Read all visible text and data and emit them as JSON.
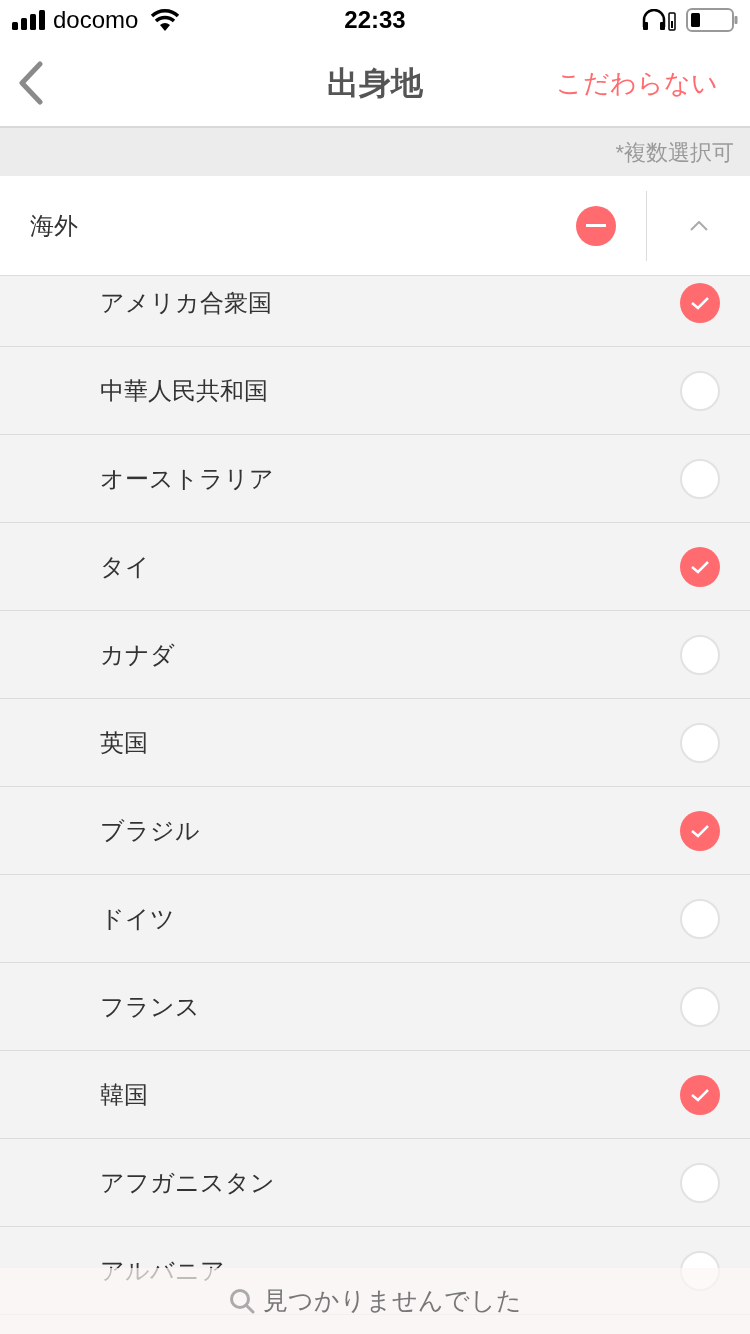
{
  "status_bar": {
    "carrier": "docomo",
    "time": "22:33"
  },
  "nav": {
    "title": "出身地",
    "action": "こだわらない"
  },
  "note": "*複数選択可",
  "section": {
    "label": "海外",
    "expanded": true,
    "all_selected": false
  },
  "countries": [
    {
      "name": "アメリカ合衆国",
      "checked": true
    },
    {
      "name": "中華人民共和国",
      "checked": false
    },
    {
      "name": "オーストラリア",
      "checked": false
    },
    {
      "name": "タイ",
      "checked": true
    },
    {
      "name": "カナダ",
      "checked": false
    },
    {
      "name": "英国",
      "checked": false
    },
    {
      "name": "ブラジル",
      "checked": true
    },
    {
      "name": "ドイツ",
      "checked": false
    },
    {
      "name": "フランス",
      "checked": false
    },
    {
      "name": "韓国",
      "checked": true
    },
    {
      "name": "アフガニスタン",
      "checked": false
    },
    {
      "name": "アルバニア",
      "checked": false
    }
  ],
  "search_status": "見つかりませんでした"
}
